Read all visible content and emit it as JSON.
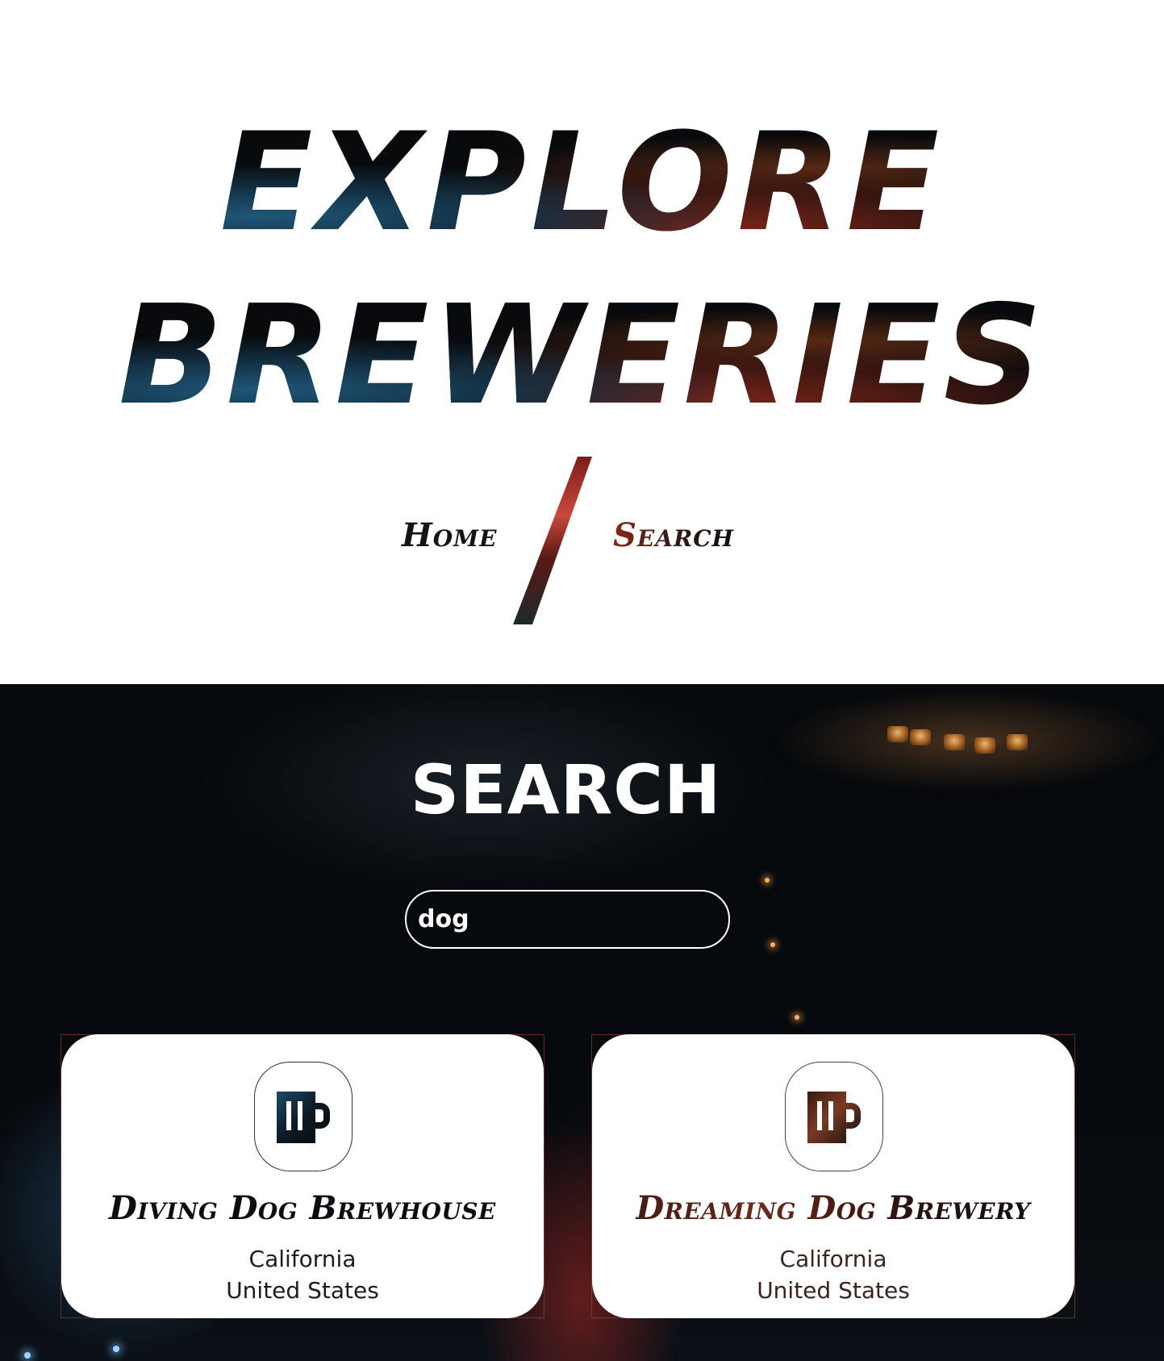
{
  "hero": {
    "title_line1": "Explore",
    "title_line2": "Breweries"
  },
  "nav": {
    "home_label": "Home",
    "search_label": "Search"
  },
  "search": {
    "heading": "SEARCH",
    "query": "dog"
  },
  "results": [
    {
      "name": "Diving Dog Brewhouse",
      "state": "California",
      "country": "United States",
      "icon": "beer-mug-icon"
    },
    {
      "name": "Dreaming Dog Brewery",
      "state": "California",
      "country": "United States",
      "icon": "beer-mug-icon"
    }
  ],
  "colors": {
    "ink": "#0b0d10",
    "accent_red": "#8a2a1a",
    "accent_blue": "#1f5678",
    "section_bg": "#06090c"
  }
}
